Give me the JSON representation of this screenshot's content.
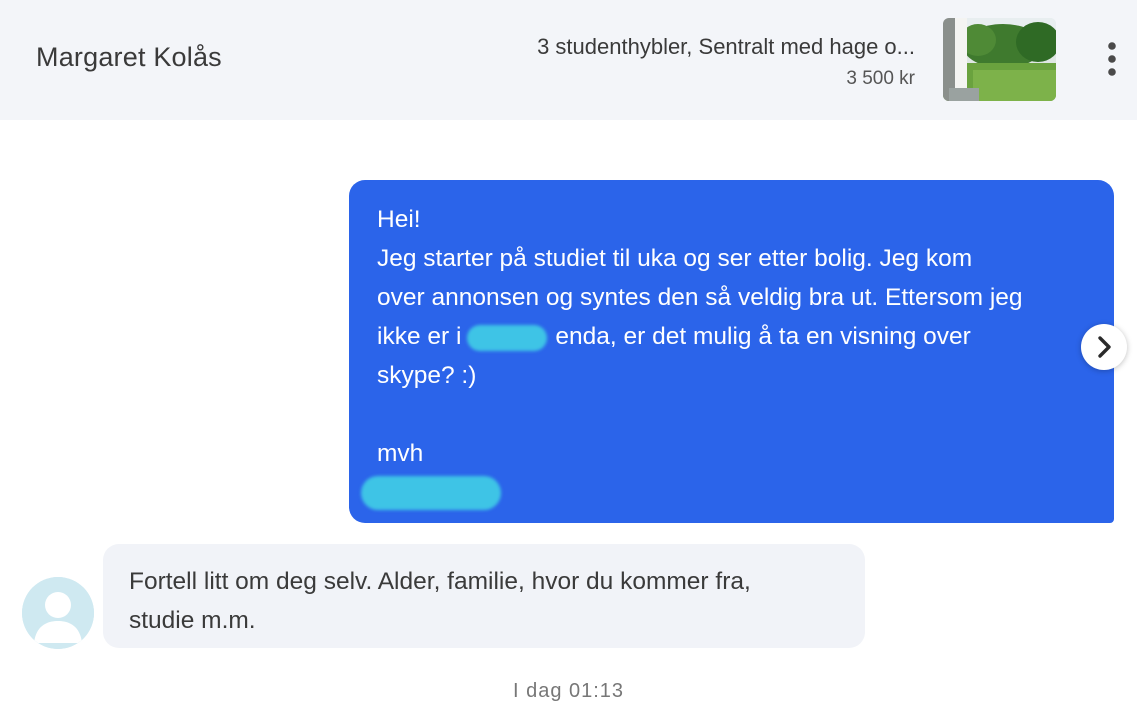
{
  "header": {
    "contact_name": "Margaret Kolås",
    "listing_title": "3 studenthybler, Sentralt med hage o...",
    "listing_price": "3 500 kr",
    "listing_thumb_icon": "listing-photo",
    "menu_icon": "more-vertical-icon"
  },
  "messages": [
    {
      "direction": "outgoing",
      "lines": {
        "l1": "Hei!",
        "l2": "Jeg starter på studiet til uka og ser etter bolig. Jeg kom",
        "l3": "over annonsen og syntes den så veldig bra ut. Ettersom jeg",
        "l4a": "ikke er i",
        "l4b": "enda, er det mulig å ta en visning over",
        "l5": "skype? :)",
        "l6": "mvh"
      },
      "redacted": true
    },
    {
      "direction": "incoming",
      "lines": {
        "l1": "Fortell litt om deg selv. Alder, familie, hvor du kommer fra,",
        "l2": "studie m.m."
      }
    }
  ],
  "timestamp": "I dag 01:13",
  "colors": {
    "outgoing_bubble": "#2b64ea",
    "incoming_bubble": "#f1f3f8",
    "header_bg": "#f3f5f9",
    "redaction": "#3ec4e6",
    "avatar_bg": "#cfe9f1"
  },
  "nav": {
    "next_icon": "chevron-right-icon"
  }
}
